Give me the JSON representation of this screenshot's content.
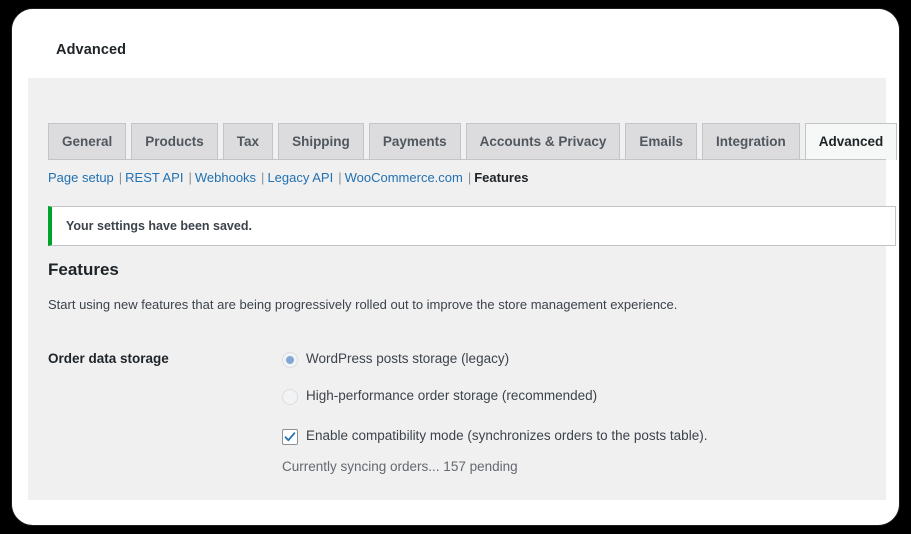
{
  "header": {
    "title": "Advanced"
  },
  "tabs": [
    {
      "label": "General",
      "active": false
    },
    {
      "label": "Products",
      "active": false
    },
    {
      "label": "Tax",
      "active": false
    },
    {
      "label": "Shipping",
      "active": false
    },
    {
      "label": "Payments",
      "active": false
    },
    {
      "label": "Accounts & Privacy",
      "active": false
    },
    {
      "label": "Emails",
      "active": false
    },
    {
      "label": "Integration",
      "active": false
    },
    {
      "label": "Advanced",
      "active": true
    }
  ],
  "subnav": {
    "links": [
      {
        "label": "Page setup"
      },
      {
        "label": "REST API"
      },
      {
        "label": "Webhooks"
      },
      {
        "label": "Legacy API"
      },
      {
        "label": "WooCommerce.com"
      }
    ],
    "separator": "|",
    "current": "Features"
  },
  "notice": {
    "message": "Your settings have been saved.",
    "accent_color": "#00a32a"
  },
  "features": {
    "heading": "Features",
    "description": "Start using new features that are being progressively rolled out to improve the store management experience.",
    "setting_label": "Order data storage",
    "options": [
      {
        "label": "WordPress posts storage (legacy)",
        "checked": true
      },
      {
        "label": "High-performance order storage (recommended)",
        "checked": false
      }
    ],
    "compatibility": {
      "label": "Enable compatibility mode (synchronizes orders to the posts table).",
      "checked": true
    },
    "sync_status": "Currently syncing orders... 157 pending"
  },
  "colors": {
    "link": "#2271b1",
    "accent_green": "#00a32a",
    "radio_fill": "#7fa8d4",
    "panel_bg": "#f0f0f1"
  }
}
